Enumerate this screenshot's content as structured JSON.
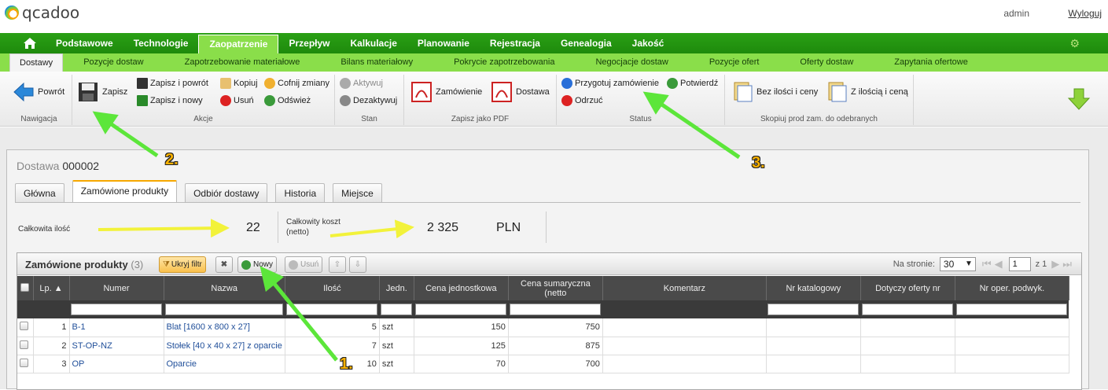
{
  "app": {
    "logo": "qcadoo",
    "user": "admin",
    "logout": "Wyloguj"
  },
  "main_nav": [
    {
      "label": "Podstawowe",
      "active": false
    },
    {
      "label": "Technologie",
      "active": false
    },
    {
      "label": "Zaopatrzenie",
      "active": true
    },
    {
      "label": "Przepływ",
      "active": false
    },
    {
      "label": "Kalkulacje",
      "active": false
    },
    {
      "label": "Planowanie",
      "active": false
    },
    {
      "label": "Rejestracja",
      "active": false
    },
    {
      "label": "Genealogia",
      "active": false
    },
    {
      "label": "Jakość",
      "active": false
    }
  ],
  "sub_nav": [
    {
      "label": "Dostawy",
      "active": true
    },
    {
      "label": "Pozycje dostaw",
      "active": false
    },
    {
      "label": "Zapotrzebowanie materiałowe",
      "active": false
    },
    {
      "label": "Bilans materiałowy",
      "active": false
    },
    {
      "label": "Pokrycie zapotrzebowania",
      "active": false
    },
    {
      "label": "Negocjacje dostaw",
      "active": false
    },
    {
      "label": "Pozycje ofert",
      "active": false
    },
    {
      "label": "Oferty dostaw",
      "active": false
    },
    {
      "label": "Zapytania ofertowe",
      "active": false
    }
  ],
  "ribbon": {
    "nav": {
      "title": "Nawigacja",
      "back": "Powrót"
    },
    "actions": {
      "title": "Akcje",
      "save": "Zapisz",
      "save_back": "Zapisz i powrót",
      "save_new": "Zapisz i nowy",
      "copy": "Kopiuj",
      "delete": "Usuń",
      "undo": "Cofnij zmiany",
      "refresh": "Odśwież"
    },
    "state": {
      "title": "Stan",
      "activate": "Aktywuj",
      "deactivate": "Dezaktywuj"
    },
    "pdf": {
      "title": "Zapisz jako PDF",
      "order": "Zamówienie",
      "delivery": "Dostawa"
    },
    "status": {
      "title": "Status",
      "prepare": "Przygotuj zamówienie",
      "confirm": "Potwierdź",
      "reject": "Odrzuć"
    },
    "copy": {
      "title": "Skopiuj prod zam. do odebranych",
      "no_qty": "Bez ilości i ceny",
      "with_qty": "Z ilością i ceną"
    }
  },
  "form": {
    "title_prefix": "Dostawa",
    "number": "000002",
    "tabs": [
      {
        "label": "Główna",
        "active": false
      },
      {
        "label": "Zamówione produkty",
        "active": true
      },
      {
        "label": "Odbiór dostawy",
        "active": false
      },
      {
        "label": "Historia",
        "active": false
      },
      {
        "label": "Miejsce",
        "active": false
      }
    ],
    "summary": {
      "total_qty_label": "Całkowita ilość",
      "total_qty": "22",
      "total_cost_label1": "Całkowity koszt",
      "total_cost_label2": "(netto)",
      "total_cost": "2 325",
      "currency": "PLN"
    }
  },
  "grid": {
    "title": "Zamówione produkty",
    "count": "(3)",
    "hide_filter": "Ukryj filtr",
    "new": "Nowy",
    "delete": "Usuń",
    "per_page_label": "Na stronie:",
    "per_page": "30",
    "page": "1",
    "of_pages": "z 1",
    "columns": [
      "Lp.",
      "Numer",
      "Nazwa",
      "Ilość",
      "Jedn.",
      "Cena jednostkowa",
      "Cena sumaryczna (netto",
      "Komentarz",
      "Nr katalogowy",
      "Dotyczy oferty nr",
      "Nr oper. podwyk."
    ],
    "rows": [
      {
        "lp": "1",
        "number": "B-1",
        "name": "Blat [1600 x 800 x 27]",
        "qty": "5",
        "unit": "szt",
        "unit_price": "150",
        "total": "750"
      },
      {
        "lp": "2",
        "number": "ST-OP-NZ",
        "name": "Stołek [40 x 40 x 27] z oparcie",
        "qty": "7",
        "unit": "szt",
        "unit_price": "125",
        "total": "875"
      },
      {
        "lp": "3",
        "number": "OP",
        "name": "Oparcie",
        "qty": "10",
        "unit": "szt",
        "unit_price": "70",
        "total": "700"
      }
    ]
  },
  "annotations": {
    "a1": "1.",
    "a2": "2.",
    "a3": "3."
  },
  "colors": {
    "nav_green": "#1e8a0c",
    "subnav_green": "#8ade4a",
    "arrow_green": "#5ce63a",
    "arrow_yellow": "#f2f23a",
    "accent_orange": "#f7a800"
  }
}
